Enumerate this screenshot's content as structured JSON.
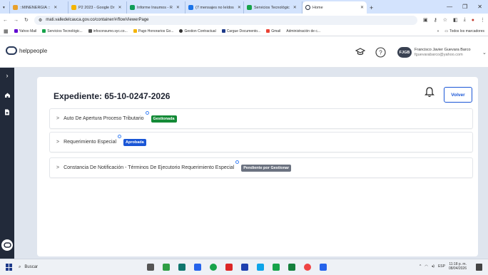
{
  "browser": {
    "tabs": [
      {
        "label": "::MINENERGIA ::",
        "color": "#e8a02c"
      },
      {
        "label": "P2 2023 - Google Dr",
        "color": "#f4b400"
      },
      {
        "label": "Informe Insumos - R",
        "color": "#0f9d58"
      },
      {
        "label": "(7 mensajes no leídos",
        "color": "#1a73e8"
      },
      {
        "label": "Servicios Tecnológic",
        "color": "#16a34a"
      },
      {
        "label": "Home",
        "color": "#222a3a"
      }
    ],
    "url": "mati.valledelcauca.gov.co/container/#/flowViewerPage",
    "bookmarks": [
      {
        "label": "Yahoo Mail",
        "color": "#6001d2"
      },
      {
        "label": "Servicios Tecnológic...",
        "color": "#16a34a"
      },
      {
        "label": "infoconsumo.syc.co...",
        "color": "#555555"
      },
      {
        "label": "Pago Honorarios Go...",
        "color": "#f4b400"
      },
      {
        "label": "Gestion Contractual",
        "color": "#333333"
      },
      {
        "label": "Cargue Documento...",
        "color": "#1e3a8a"
      },
      {
        "label": "Gmail",
        "color": "#ea4335"
      },
      {
        "label": "Administración de c...",
        "color": "#888888"
      }
    ],
    "bookmarks_overflow": "»",
    "all_bookmarks": "Todos los marcadores"
  },
  "app": {
    "logo_text": "helppeople",
    "user": {
      "initials": "FJGB",
      "name": "Francisco Javier Guevara Barco",
      "email": "fguevarabarco@yahoo.com"
    },
    "title": "Expediente: 65-10-0247-2026",
    "back_button": "Volver",
    "items": [
      {
        "label": "Auto De Apertura Proceso Tributario",
        "status": "Gestionada",
        "status_color": "#138a36"
      },
      {
        "label": "Requerimiento Especial",
        "status": "Aprobada",
        "status_color": "#1a56d6"
      },
      {
        "label": "Constancia De Notificación - Términos De Ejecutorio Requerimiento Especial",
        "status": "Pendiente por Gestionar",
        "status_color": "#6b7280"
      }
    ]
  },
  "taskbar": {
    "search_placeholder": "Buscar",
    "language": "ESP",
    "time": "11:18 p. m.",
    "date": "08/04/2026",
    "app_colors": [
      "#555555",
      "#2f9e44",
      "#0f766e",
      "#2563eb",
      "#16a34a",
      "#dc2626",
      "#1e40af",
      "#0ea5e9",
      "#16a34a",
      "#ef4444",
      "#f59e0b",
      "#2563eb"
    ]
  },
  "icons": {
    "bell": "bell-icon",
    "help": "help-icon",
    "graduation": "graduation-cap-icon",
    "home": "home-icon",
    "document": "document-icon"
  }
}
